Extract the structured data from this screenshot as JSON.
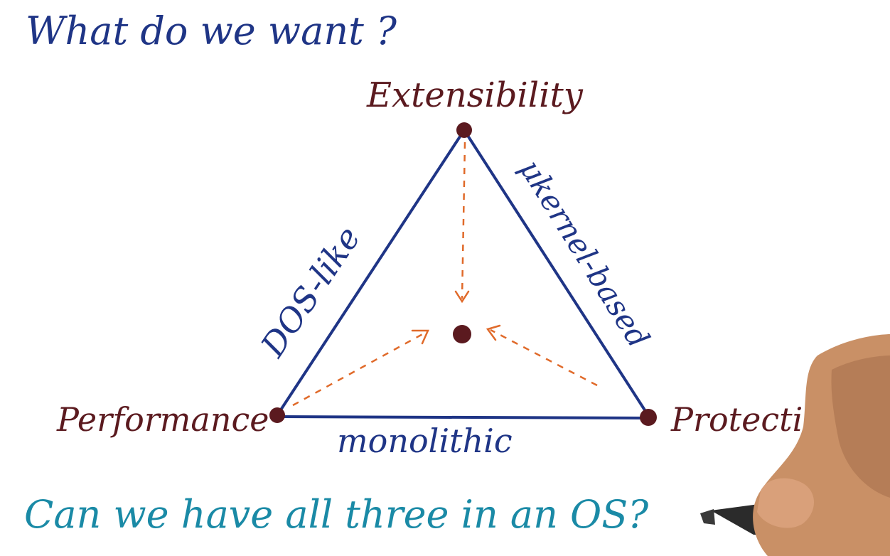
{
  "heading": "What do we want ?",
  "vertices": {
    "top": "Extensibility",
    "left": "Performance",
    "right": "Protection"
  },
  "edges": {
    "left": "DOS-like",
    "right": "μkernel-based",
    "bottom": "monolithic"
  },
  "question": "Can we have all three in an OS?",
  "colors": {
    "heading": "#1f3586",
    "edge_lines": "#1f3586",
    "vertex_labels": "#5b1a1f",
    "arrows": "#e06a2a",
    "question": "#1a8aa6"
  }
}
